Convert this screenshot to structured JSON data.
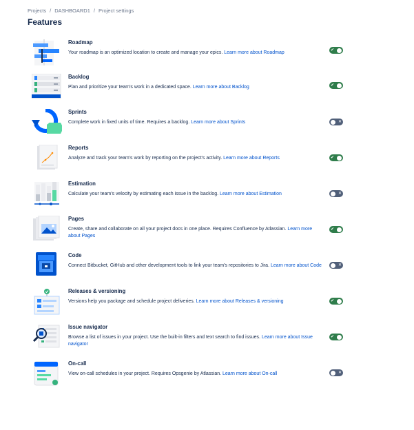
{
  "breadcrumb": {
    "items": [
      "Projects",
      "DASHBOARD1",
      "Project settings"
    ],
    "separator": "/"
  },
  "page": {
    "title": "Features"
  },
  "colors": {
    "toggle_on": "#2f7d4b",
    "toggle_off": "#505f79",
    "link": "#0052cc"
  },
  "features": [
    {
      "name": "Roadmap",
      "desc": "Your roadmap is an optimized location to create and manage your epics.",
      "link": "Learn more about Roadmap",
      "enabled": true,
      "icon": "roadmap-icon"
    },
    {
      "name": "Backlog",
      "desc": "Plan and prioritize your team's work in a dedicated space.",
      "link": "Learn more about Backlog",
      "enabled": true,
      "icon": "backlog-icon"
    },
    {
      "name": "Sprints",
      "desc": "Complete work in fixed units of time. Requires a backlog.",
      "link": "Learn more about Sprints",
      "enabled": false,
      "icon": "sprints-icon"
    },
    {
      "name": "Reports",
      "desc": "Analyze and track your team's work by reporting on the project's activity.",
      "link": "Learn more about Reports",
      "enabled": true,
      "icon": "reports-icon"
    },
    {
      "name": "Estimation",
      "desc": "Calculate your team's velocity by estimating each issue in the backlog.",
      "link": "Learn more about Estimation",
      "enabled": false,
      "icon": "estimation-icon"
    },
    {
      "name": "Pages",
      "desc": "Create, share and collaborate on all your project docs in one place. Requires Confluence by Atlassian.",
      "link": "Learn more about Pages",
      "enabled": true,
      "icon": "pages-icon"
    },
    {
      "name": "Code",
      "desc": "Connect Bitbucket, GitHub and other development tools to link your team's repositories to Jira.",
      "link": "Learn more about Code",
      "enabled": false,
      "icon": "code-icon"
    },
    {
      "name": "Releases & versioning",
      "desc": "Versions help you package and schedule project deliveries.",
      "link": "Learn more about Releases & versioning",
      "enabled": true,
      "icon": "releases-icon"
    },
    {
      "name": "Issue navigator",
      "desc": "Browse a list of issues in your project. Use the built-in filters and text search to find issues.",
      "link": "Learn more about Issue navigator",
      "enabled": true,
      "icon": "issue-navigator-icon"
    },
    {
      "name": "On-call",
      "desc": "View on-call schedules in your project. Requires Opsgenie by Atlassian.",
      "link": "Learn more about On-call",
      "enabled": false,
      "icon": "on-call-icon"
    }
  ]
}
